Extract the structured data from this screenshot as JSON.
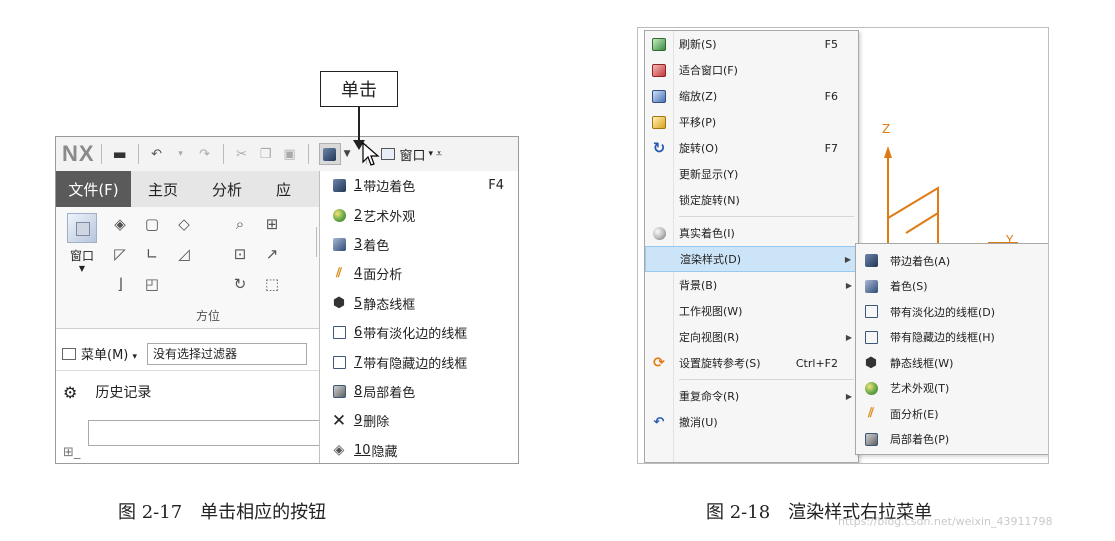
{
  "figure17": {
    "callout": "单击",
    "logo": "NX",
    "qat_window_menu": "窗口",
    "tabs": {
      "file": "文件(F)",
      "home": "主页",
      "analysis": "分析",
      "app_cut": "应"
    },
    "ribbon": {
      "window_button": "窗口",
      "group_label": "方位"
    },
    "menu_button": "菜单(M)",
    "filter_select": "没有选择过滤器",
    "history_label": "历史记录",
    "dropdown": [
      {
        "num": "1",
        "label": "带边着色",
        "shortcut": "F4",
        "icon": "shaded-with-edges-icon"
      },
      {
        "num": "2",
        "label": "艺术外观",
        "shortcut": "",
        "icon": "studio-icon"
      },
      {
        "num": "3",
        "label": "着色",
        "shortcut": "",
        "icon": "shaded-icon"
      },
      {
        "num": "4",
        "label": "面分析",
        "shortcut": "",
        "icon": "face-analysis-icon"
      },
      {
        "num": "5",
        "label": "静态线框",
        "shortcut": "",
        "icon": "static-wireframe-icon"
      },
      {
        "num": "6",
        "label": "带有淡化边的线框",
        "shortcut": "",
        "icon": "wireframe-dim-edges-icon"
      },
      {
        "num": "7",
        "label": "带有隐藏边的线框",
        "shortcut": "",
        "icon": "wireframe-hidden-edges-icon"
      },
      {
        "num": "8",
        "label": "局部着色",
        "shortcut": "",
        "icon": "partial-shading-icon"
      },
      {
        "num": "9",
        "label": "删除",
        "shortcut": "",
        "icon": "delete-icon"
      },
      {
        "num": "10",
        "label": "隐藏",
        "shortcut": "",
        "icon": "hide-icon"
      }
    ],
    "caption": "图 2-17　单击相应的按钮"
  },
  "figure18": {
    "menu": [
      {
        "label": "刷新(S)",
        "shortcut": "F5",
        "icon": "refresh-icon"
      },
      {
        "label": "适合窗口(F)",
        "shortcut": "",
        "icon": "fit-window-icon"
      },
      {
        "label": "缩放(Z)",
        "shortcut": "F6",
        "icon": "zoom-icon"
      },
      {
        "label": "平移(P)",
        "shortcut": "",
        "icon": "pan-icon"
      },
      {
        "label": "旋转(O)",
        "shortcut": "F7",
        "icon": "rotate-icon"
      },
      {
        "label": "更新显示(Y)",
        "shortcut": "",
        "icon": ""
      },
      {
        "label": "锁定旋转(N)",
        "shortcut": "",
        "icon": ""
      }
    ],
    "menu2": [
      {
        "label": "真实着色(I)",
        "shortcut": "",
        "icon": "true-shading-icon",
        "submenu": false,
        "highlight": false
      },
      {
        "label": "渲染样式(D)",
        "shortcut": "",
        "icon": "",
        "submenu": true,
        "highlight": true
      },
      {
        "label": "背景(B)",
        "shortcut": "",
        "icon": "",
        "submenu": true,
        "highlight": false
      },
      {
        "label": "工作视图(W)",
        "shortcut": "",
        "icon": "",
        "submenu": false,
        "highlight": false
      },
      {
        "label": "定向视图(R)",
        "shortcut": "",
        "icon": "",
        "submenu": true,
        "highlight": false
      },
      {
        "label": "设置旋转参考(S)",
        "shortcut": "Ctrl+F2",
        "icon": "set-rotation-reference-icon",
        "submenu": false,
        "highlight": false
      }
    ],
    "menu3": [
      {
        "label": "重复命令(R)",
        "shortcut": "",
        "icon": "",
        "submenu": true
      },
      {
        "label": "撤消(U)",
        "shortcut": "",
        "icon": "undo-icon",
        "submenu": false
      }
    ],
    "submenu": [
      {
        "label": "带边着色(A)",
        "icon": "shaded-with-edges-icon"
      },
      {
        "label": "着色(S)",
        "icon": "shaded-icon"
      },
      {
        "label": "带有淡化边的线框(D)",
        "icon": "wireframe-dim-edges-icon"
      },
      {
        "label": "带有隐藏边的线框(H)",
        "icon": "wireframe-hidden-edges-icon"
      },
      {
        "label": "静态线框(W)",
        "icon": "static-wireframe-icon"
      },
      {
        "label": "艺术外观(T)",
        "icon": "studio-icon"
      },
      {
        "label": "面分析(E)",
        "icon": "face-analysis-icon"
      },
      {
        "label": "局部着色(P)",
        "icon": "partial-shading-icon"
      }
    ],
    "axis_z": "Z",
    "axis_y": "Y",
    "caption": "图 2-18　渲染样式右拉菜单"
  },
  "watermark": "https://blog.csdn.net/weixin_43911798",
  "colors": {
    "file_tab_bg": "#5a5a5a",
    "highlight_bg": "#cce4f7",
    "model_orange": "#e07b14"
  }
}
